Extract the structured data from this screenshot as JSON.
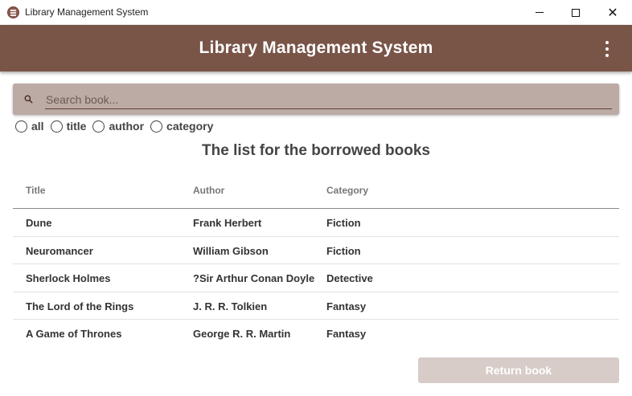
{
  "window": {
    "title": "Library Management System"
  },
  "appbar": {
    "title": "Library Management System"
  },
  "search": {
    "placeholder": "Search book..."
  },
  "filters": [
    {
      "label": "all"
    },
    {
      "label": "title"
    },
    {
      "label": "author"
    },
    {
      "label": "category"
    }
  ],
  "list_heading": "The list for the borrowed books",
  "table": {
    "headers": [
      "Title",
      "Author",
      "Category"
    ],
    "rows": [
      [
        "Dune",
        "Frank Herbert",
        "Fiction"
      ],
      [
        "Neuromancer",
        "William Gibson",
        "Fiction"
      ],
      [
        "Sherlock Holmes",
        "?Sir Arthur Conan Doyle",
        "Detective"
      ],
      [
        "The Lord of the Rings",
        "J. R. R. Tolkien",
        "Fantasy"
      ],
      [
        "A Game of Thrones",
        "George R. R. Martin",
        "Fantasy"
      ]
    ]
  },
  "actions": {
    "return_label": "Return book"
  },
  "colors": {
    "primary": "#795548",
    "search_bg": "#bcaaa4",
    "button_disabled": "#d7ccc8"
  },
  "icons": {
    "app": "app-icon",
    "search": "search-icon",
    "menu": "more-vert-icon"
  }
}
